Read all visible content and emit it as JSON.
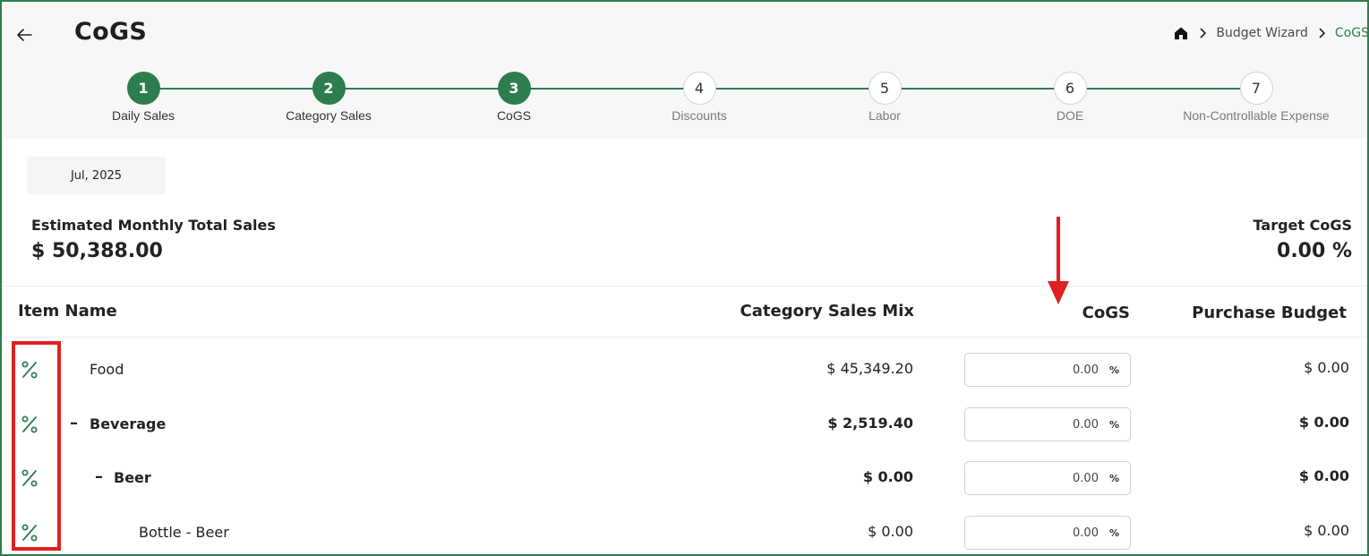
{
  "header": {
    "title": "CoGS",
    "breadcrumb": {
      "home_icon": "home-icon",
      "items": [
        "Budget Wizard",
        "CoGS"
      ]
    }
  },
  "stepper": {
    "steps": [
      {
        "number": "1",
        "label": "Daily Sales",
        "state": "done"
      },
      {
        "number": "2",
        "label": "Category Sales",
        "state": "done"
      },
      {
        "number": "3",
        "label": "CoGS",
        "state": "done"
      },
      {
        "number": "4",
        "label": "Discounts",
        "state": "todo"
      },
      {
        "number": "5",
        "label": "Labor",
        "state": "todo"
      },
      {
        "number": "6",
        "label": "DOE",
        "state": "todo"
      },
      {
        "number": "7",
        "label": "Non-Controllable Expense",
        "state": "todo"
      }
    ]
  },
  "period": {
    "label": "Jul, 2025"
  },
  "summary": {
    "sales_label": "Estimated Monthly Total Sales",
    "sales_value": "$ 50,388.00",
    "target_label": "Target CoGS",
    "target_value": "0.00 %"
  },
  "table": {
    "headers": {
      "item_name": "Item Name",
      "sales_mix": "Category Sales Mix",
      "cogs": "CoGS",
      "purchase_budget": "Purchase Budget"
    },
    "rows": [
      {
        "name": "Food",
        "toggle": "",
        "mix": "$ 45,349.20",
        "cogs": "0.00",
        "unit": "%",
        "purchase": "$ 0.00"
      },
      {
        "name": "Beverage",
        "toggle": "–",
        "mix": "$ 2,519.40",
        "cogs": "0.00",
        "unit": "%",
        "purchase": "$ 0.00"
      },
      {
        "name": "Beer",
        "toggle": "–",
        "mix": "$ 0.00",
        "cogs": "0.00",
        "unit": "%",
        "purchase": "$ 0.00"
      },
      {
        "name": "Bottle - Beer",
        "toggle": "",
        "mix": "$ 0.00",
        "cogs": "0.00",
        "unit": "%",
        "purchase": "$ 0.00"
      }
    ]
  },
  "colors": {
    "brand_green": "#2e7d4f",
    "annotation_red": "#e02020"
  }
}
